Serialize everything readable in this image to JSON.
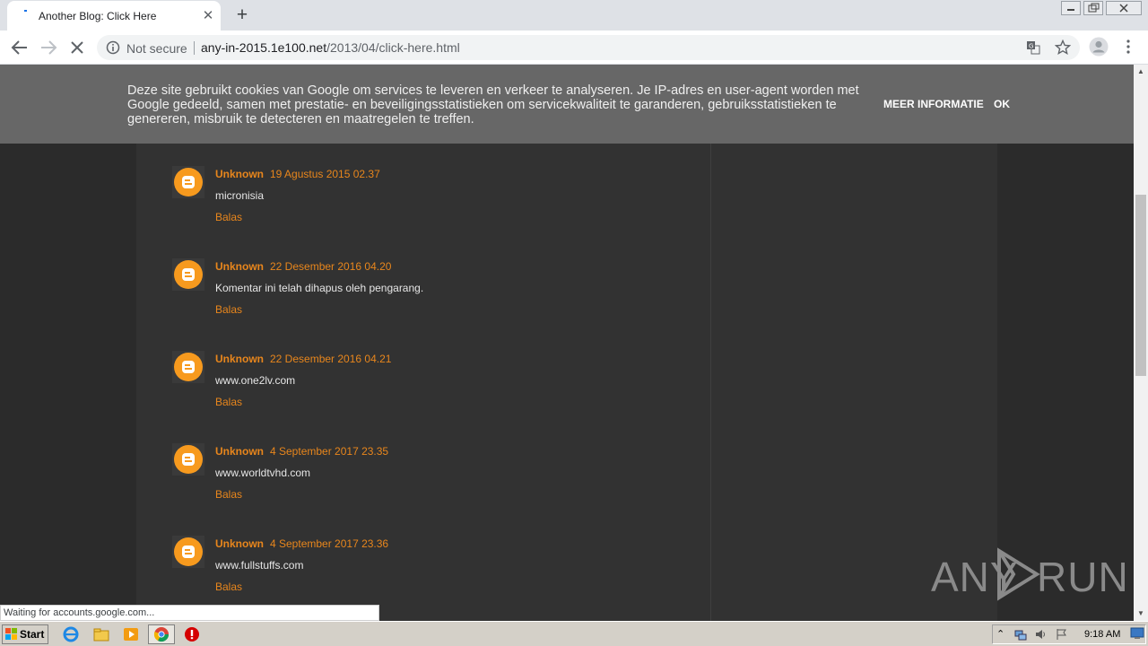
{
  "browser": {
    "tab_title": "Another Blog: Click Here",
    "tab_close": "✕",
    "new_tab": "+",
    "security_label": "Not secure",
    "url_host": "any-in-2015.1e100.net",
    "url_path": "/2013/04/click-here.html",
    "status_text": "Waiting for accounts.google.com..."
  },
  "cookie_banner": {
    "text": "Deze site gebruikt cookies van Google om services te leveren en verkeer te analyseren. Je IP-adres en user-agent worden met Google gedeeld, samen met prestatie- en beveiligingsstatistieken om servicekwaliteit te garanderen, gebruiksstatistieken te genereren, misbruik te detecteren en maatregelen te treffen.",
    "more_label": "MEER INFORMATIE",
    "ok_label": "OK"
  },
  "comments": [
    {
      "author": "Unknown",
      "date": "19 Agustus 2015 02.37",
      "text": "micronisia",
      "reply": "Balas"
    },
    {
      "author": "Unknown",
      "date": "22 Desember 2016 04.20",
      "text": "Komentar ini telah dihapus oleh pengarang.",
      "reply": "Balas"
    },
    {
      "author": "Unknown",
      "date": "22 Desember 2016 04.21",
      "text": "www.one2lv.com",
      "reply": "Balas"
    },
    {
      "author": "Unknown",
      "date": "4 September 2017 23.35",
      "text": "www.worldtvhd.com",
      "reply": "Balas"
    },
    {
      "author": "Unknown",
      "date": "4 September 2017 23.36",
      "text": "www.fullstuffs.com",
      "reply": "Balas"
    }
  ],
  "watermark": {
    "left": "ANY",
    "right": "RUN"
  },
  "taskbar": {
    "start_label": "Start",
    "clock": "9:18 AM"
  },
  "colors": {
    "accent": "#e8861c",
    "page_bg": "#2b2b2b",
    "column_bg": "#323232",
    "banner_bg": "#676767"
  }
}
